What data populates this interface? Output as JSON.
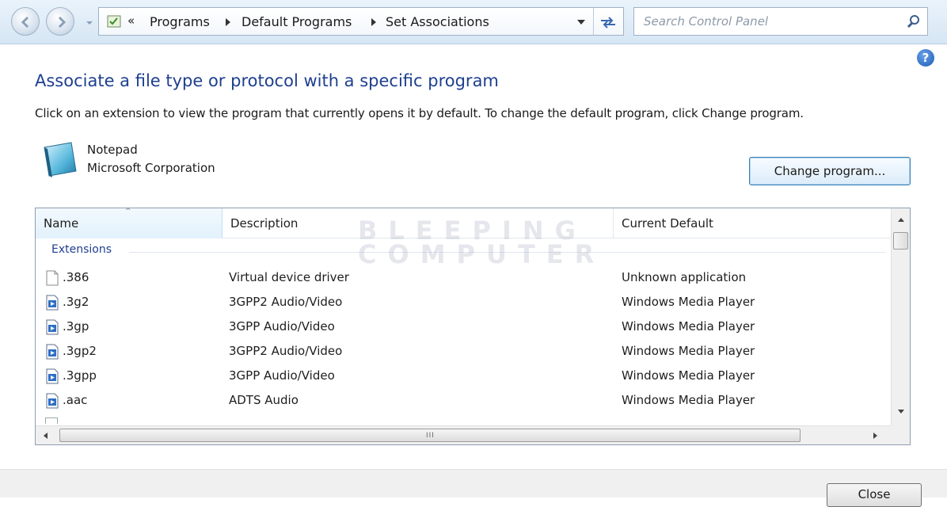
{
  "nav": {
    "back_icon": "back-arrow-icon",
    "forward_icon": "forward-arrow-icon",
    "breadcrumb_overflow": "«",
    "breadcrumbs": [
      "Programs",
      "Default Programs",
      "Set Associations"
    ],
    "search_placeholder": "Search Control Panel"
  },
  "help_label": "?",
  "page": {
    "title": "Associate a file type or protocol with a specific program",
    "description": "Click on an extension to view the program that currently opens it by default. To change the default program, click Change program."
  },
  "program": {
    "name": "Notepad",
    "publisher": "Microsoft Corporation",
    "change_button": "Change program..."
  },
  "list": {
    "columns": [
      "Name",
      "Description",
      "Current Default"
    ],
    "group": "Extensions",
    "rows": [
      {
        "name": ".386",
        "description": "Virtual device driver",
        "default": "Unknown application",
        "icon": "blank-file-icon"
      },
      {
        "name": ".3g2",
        "description": "3GPP2 Audio/Video",
        "default": "Windows Media Player",
        "icon": "media-file-icon"
      },
      {
        "name": ".3gp",
        "description": "3GPP Audio/Video",
        "default": "Windows Media Player",
        "icon": "media-file-icon"
      },
      {
        "name": ".3gp2",
        "description": "3GPP2 Audio/Video",
        "default": "Windows Media Player",
        "icon": "media-file-icon"
      },
      {
        "name": ".3gpp",
        "description": "3GPP Audio/Video",
        "default": "Windows Media Player",
        "icon": "media-file-icon"
      },
      {
        "name": ".aac",
        "description": "ADTS Audio",
        "default": "Windows Media Player",
        "icon": "media-file-icon"
      }
    ],
    "scroll_grip": "III"
  },
  "watermark": [
    "BLEEPING",
    "COMPUTER"
  ],
  "footer": {
    "close_button": "Close"
  }
}
